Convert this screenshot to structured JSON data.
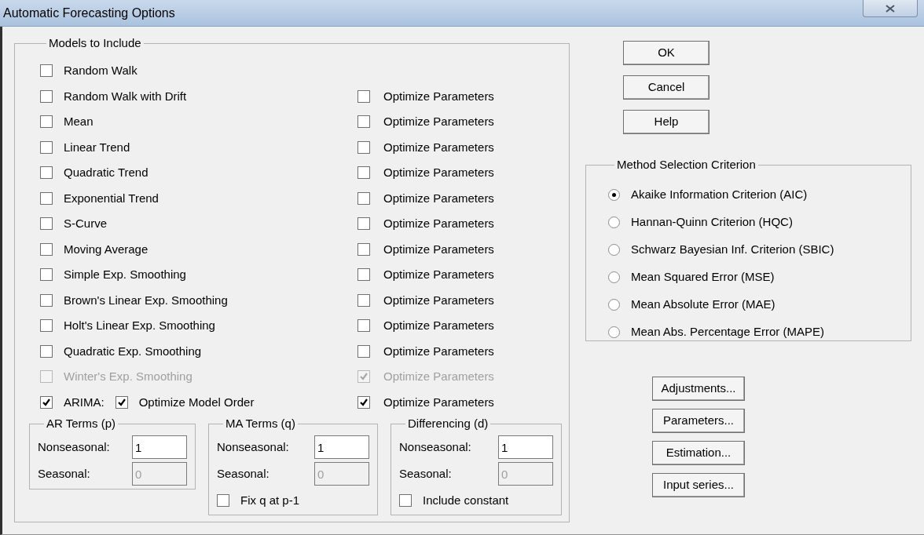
{
  "window": {
    "title": "Automatic Forecasting Options"
  },
  "models_group": {
    "title": "Models to Include",
    "models": [
      {
        "label": "Random Walk",
        "checked": false,
        "disabled": false
      },
      {
        "label": "Random Walk with Drift",
        "checked": false,
        "disabled": false,
        "optimize": {
          "label": "Optimize Parameters",
          "checked": false,
          "disabled": false
        }
      },
      {
        "label": "Mean",
        "checked": false,
        "disabled": false,
        "optimize": {
          "label": "Optimize Parameters",
          "checked": false,
          "disabled": false
        }
      },
      {
        "label": "Linear Trend",
        "checked": false,
        "disabled": false,
        "optimize": {
          "label": "Optimize Parameters",
          "checked": false,
          "disabled": false
        }
      },
      {
        "label": "Quadratic Trend",
        "checked": false,
        "disabled": false,
        "optimize": {
          "label": "Optimize Parameters",
          "checked": false,
          "disabled": false
        }
      },
      {
        "label": "Exponential Trend",
        "checked": false,
        "disabled": false,
        "optimize": {
          "label": "Optimize Parameters",
          "checked": false,
          "disabled": false
        }
      },
      {
        "label": "S-Curve",
        "checked": false,
        "disabled": false,
        "optimize": {
          "label": "Optimize Parameters",
          "checked": false,
          "disabled": false
        }
      },
      {
        "label": "Moving Average",
        "checked": false,
        "disabled": false,
        "optimize": {
          "label": "Optimize Parameters",
          "checked": false,
          "disabled": false
        }
      },
      {
        "label": "Simple Exp. Smoothing",
        "checked": false,
        "disabled": false,
        "optimize": {
          "label": "Optimize Parameters",
          "checked": false,
          "disabled": false
        }
      },
      {
        "label": "Brown's Linear Exp. Smoothing",
        "checked": false,
        "disabled": false,
        "optimize": {
          "label": "Optimize Parameters",
          "checked": false,
          "disabled": false
        }
      },
      {
        "label": "Holt's Linear Exp. Smoothing",
        "checked": false,
        "disabled": false,
        "optimize": {
          "label": "Optimize Parameters",
          "checked": false,
          "disabled": false
        }
      },
      {
        "label": "Quadratic Exp. Smoothing",
        "checked": false,
        "disabled": false,
        "optimize": {
          "label": "Optimize Parameters",
          "checked": false,
          "disabled": false
        }
      },
      {
        "label": "Winter's Exp. Smoothing",
        "checked": false,
        "disabled": true,
        "optimize": {
          "label": "Optimize Parameters",
          "checked": true,
          "disabled": true
        }
      },
      {
        "label": "ARIMA:",
        "checked": true,
        "disabled": false,
        "order_option": {
          "label": "Optimize Model Order",
          "checked": true,
          "disabled": false
        },
        "optimize": {
          "label": "Optimize Parameters",
          "checked": true,
          "disabled": false
        }
      }
    ],
    "terms_groups": [
      {
        "title": "AR Terms (p)",
        "fields": [
          {
            "label": "Nonseasonal:",
            "value": "1",
            "disabled": false
          },
          {
            "label": "Seasonal:",
            "value": "0",
            "disabled": true
          }
        ]
      },
      {
        "title": "MA Terms (q)",
        "fields": [
          {
            "label": "Nonseasonal:",
            "value": "1",
            "disabled": false
          },
          {
            "label": "Seasonal:",
            "value": "0",
            "disabled": true
          }
        ],
        "option": {
          "label": "Fix q at p-1",
          "checked": false
        }
      },
      {
        "title": "Differencing (d)",
        "fields": [
          {
            "label": "Nonseasonal:",
            "value": "1",
            "disabled": false
          },
          {
            "label": "Seasonal:",
            "value": "0",
            "disabled": true
          }
        ],
        "option": {
          "label": "Include constant",
          "checked": false
        }
      }
    ]
  },
  "dialog_buttons": [
    "OK",
    "Cancel",
    "Help"
  ],
  "method_group": {
    "title": "Method Selection Criterion",
    "options": [
      {
        "label": "Akaike Information Criterion (AIC)",
        "selected": true
      },
      {
        "label": "Hannan-Quinn Criterion (HQC)",
        "selected": false
      },
      {
        "label": "Schwarz Bayesian Inf. Criterion (SBIC)",
        "selected": false
      },
      {
        "label": "Mean Squared Error (MSE)",
        "selected": false
      },
      {
        "label": "Mean Absolute Error (MAE)",
        "selected": false
      },
      {
        "label": "Mean Abs. Percentage Error (MAPE)",
        "selected": false
      }
    ]
  },
  "action_buttons": [
    "Adjustments...",
    "Parameters...",
    "Estimation...",
    "Input series..."
  ]
}
